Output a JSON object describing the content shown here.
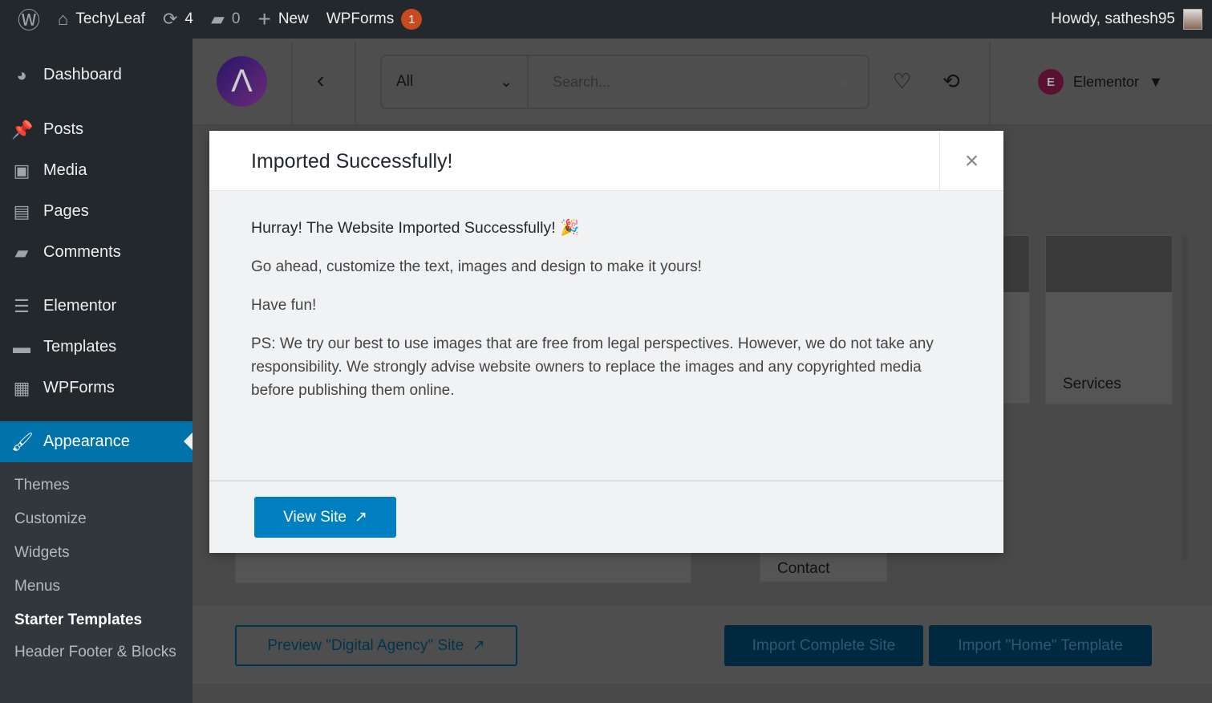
{
  "adminbar": {
    "site": "TechyLeaf",
    "updates": "4",
    "comments": "0",
    "new": "New",
    "wpforms": "WPForms",
    "wpforms_badge": "1",
    "howdy": "Howdy, sathesh95"
  },
  "sidebar": {
    "items": [
      {
        "label": "Dashboard",
        "icon": "dashboard-icon"
      },
      {
        "label": "Posts",
        "icon": "pin-icon"
      },
      {
        "label": "Media",
        "icon": "media-icon"
      },
      {
        "label": "Pages",
        "icon": "pages-icon"
      },
      {
        "label": "Comments",
        "icon": "comment-icon"
      },
      {
        "label": "Elementor",
        "icon": "elementor-icon"
      },
      {
        "label": "Templates",
        "icon": "folder-icon"
      },
      {
        "label": "WPForms",
        "icon": "form-icon"
      },
      {
        "label": "Appearance",
        "icon": "brush-icon"
      }
    ],
    "submenu": [
      "Themes",
      "Customize",
      "Widgets",
      "Menus",
      "Starter Templates",
      "Header Footer & Blocks"
    ]
  },
  "toolbar": {
    "filter": "All",
    "search_placeholder": "Search...",
    "builder": "Elementor"
  },
  "background": {
    "card_services": "Services",
    "card_contact": "Contact",
    "preview_button": "Preview \"Digital Agency\" Site",
    "import_site": "Import Complete Site",
    "import_template": "Import \"Home\" Template"
  },
  "modal": {
    "title": "Imported Successfully!",
    "headline": "Hurray! The Website Imported Successfully! 🎉",
    "line1": "Go ahead, customize the text, images and design to make it yours!",
    "line2": "Have fun!",
    "ps": "PS: We try our best to use images that are free from legal perspectives. However, we do not take any responsibility. We strongly advise website owners to replace the images and any copyrighted media before publishing them online.",
    "view_site": "View Site"
  },
  "colors": {
    "accent": "#0073aa",
    "button": "#0080c0",
    "adminbar": "#23282d"
  }
}
